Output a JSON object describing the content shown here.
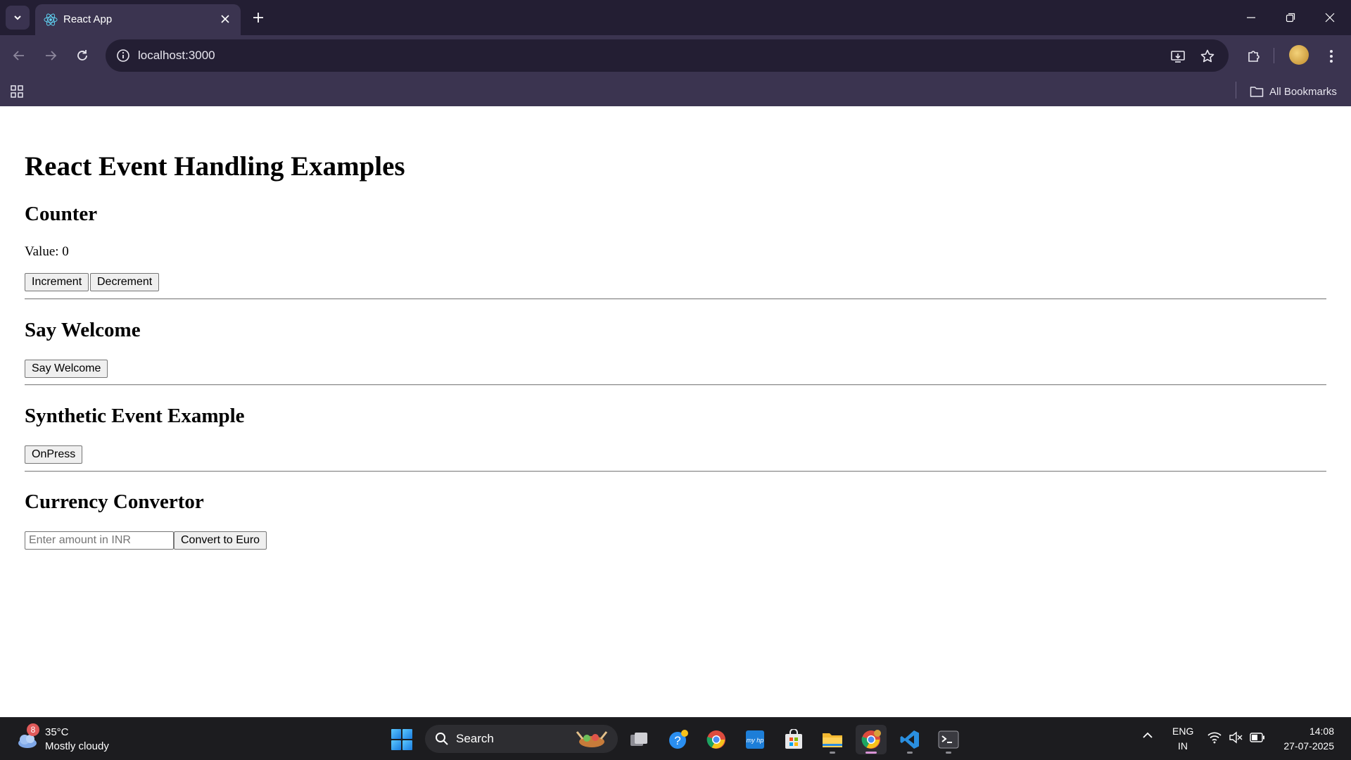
{
  "browser": {
    "tab_title": "React App",
    "url": "localhost:3000",
    "all_bookmarks": "All Bookmarks"
  },
  "page": {
    "title": "React Event Handling Examples",
    "counter": {
      "heading": "Counter",
      "value_text": "Value: 0",
      "increment_label": "Increment",
      "decrement_label": "Decrement"
    },
    "welcome": {
      "heading": "Say Welcome",
      "button_label": "Say Welcome"
    },
    "synthetic": {
      "heading": "Synthetic Event Example",
      "button_label": "OnPress"
    },
    "currency": {
      "heading": "Currency Convertor",
      "input_placeholder": "Enter amount in INR",
      "input_value": "",
      "button_label": "Convert to Euro"
    }
  },
  "taskbar": {
    "weather_badge": "8",
    "weather_temp": "35°C",
    "weather_desc": "Mostly cloudy",
    "search_label": "Search",
    "lang_top": "ENG",
    "lang_bottom": "IN",
    "time": "14:08",
    "date": "27-07-2025"
  },
  "colors": {
    "chrome_dark": "#231e33",
    "chrome_mid": "#3b3450",
    "taskbar": "#1c1c1f",
    "react_blue": "#61dafb"
  }
}
